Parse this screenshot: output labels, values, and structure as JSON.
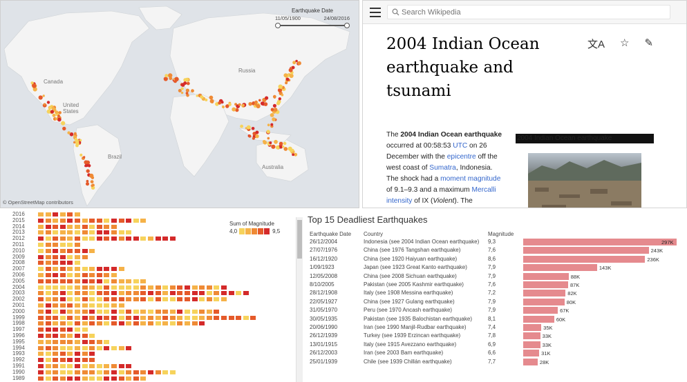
{
  "map": {
    "labels": {
      "canada": "Canada",
      "united_states": "United\nStates",
      "russia": "Russia",
      "brazil": "Brazil",
      "australia": "Australia"
    },
    "copyright": "© OpenStreetMap contributors",
    "slider": {
      "title": "Earthquake Date",
      "start": "11/05/1900",
      "end": "24/08/2016"
    }
  },
  "wiki": {
    "search_placeholder": "Search Wikipedia",
    "title": "2004 Indian Ocean earthquake and tsunami",
    "icons": [
      "translate-icon",
      "star-icon",
      "pencil-icon"
    ],
    "infobox_caption": "2004 Indian Ocean earthquake",
    "body": {
      "t1": "The ",
      "b1": "2004 Indian Ocean earthquake",
      "t2": " occurred at 00:58:53 ",
      "l1": "UTC",
      "t3": " on 26 December with the ",
      "l2": "epicentre",
      "t4": " off the west coast of ",
      "l3": "Sumatra",
      "t5": ", Indonesia. The shock had a ",
      "l4": "moment magnitude",
      "t6": " of 9.1–9.3 and a maximum ",
      "l5": "Mercalli intensity",
      "t7": " of IX (",
      "i1": "Violent",
      "t8": "). The"
    }
  },
  "timeline": {
    "years": [
      "2016",
      "2015",
      "2014",
      "2013",
      "2012",
      "2011",
      "2010",
      "2009",
      "2008",
      "2007",
      "2006",
      "2005",
      "2004",
      "2003",
      "2002",
      "2001",
      "2000",
      "1999",
      "1998",
      "1997",
      "1996",
      "1995",
      "1994",
      "1993",
      "1992",
      "1991",
      "1990",
      "1989"
    ],
    "legend_title": "Sum of Magnitude",
    "legend_min": "4,0",
    "legend_max": "9,5",
    "colors": [
      "#f6d35c",
      "#f5b248",
      "#ef8a35",
      "#e55a2a",
      "#d42a2a"
    ]
  },
  "top15": {
    "title": "Top 15 Deadliest Earthquakes",
    "headers": {
      "date": "Earthquake Date",
      "country": "Country",
      "magnitude": "Magnitude"
    },
    "rows": [
      {
        "date": "26/12/2004",
        "country": "Indonesia (see 2004 Indian Ocean earthquake)",
        "magnitude": "9,3",
        "deaths": 297,
        "label": "297K"
      },
      {
        "date": "27/07/1976",
        "country": "China (see 1976 Tangshan earthquake)",
        "magnitude": "7,6",
        "deaths": 243,
        "label": "243K"
      },
      {
        "date": "16/12/1920",
        "country": "China (see 1920 Haiyuan earthquake)",
        "magnitude": "8,6",
        "deaths": 236,
        "label": "236K"
      },
      {
        "date": "1/09/1923",
        "country": "Japan (see 1923 Great Kanto earthquake)",
        "magnitude": "7,9",
        "deaths": 143,
        "label": "143K"
      },
      {
        "date": "12/05/2008",
        "country": "China (see 2008 Sichuan earthquake)",
        "magnitude": "7,9",
        "deaths": 88,
        "label": "88K"
      },
      {
        "date": "8/10/2005",
        "country": "Pakistan (see 2005 Kashmir earthquake)",
        "magnitude": "7,6",
        "deaths": 87,
        "label": "87K"
      },
      {
        "date": "28/12/1908",
        "country": "Italy (see 1908 Messina earthquake)",
        "magnitude": "7,2",
        "deaths": 82,
        "label": "82K"
      },
      {
        "date": "22/05/1927",
        "country": "China (see 1927 Gulang earthquake)",
        "magnitude": "7,9",
        "deaths": 80,
        "label": "80K"
      },
      {
        "date": "31/05/1970",
        "country": "Peru (see 1970 Ancash earthquake)",
        "magnitude": "7,9",
        "deaths": 67,
        "label": "67K"
      },
      {
        "date": "30/05/1935",
        "country": "Pakistan (see 1935 Balochistan earthquake)",
        "magnitude": "8,1",
        "deaths": 60,
        "label": "60K"
      },
      {
        "date": "20/06/1990",
        "country": "Iran (see 1990 Manjil-Rudbar earthquake)",
        "magnitude": "7,4",
        "deaths": 35,
        "label": "35K"
      },
      {
        "date": "26/12/1939",
        "country": "Turkey (see 1939 Erzincan earthquake)",
        "magnitude": "7,8",
        "deaths": 33,
        "label": "33K"
      },
      {
        "date": "13/01/1915",
        "country": "Italy (see 1915 Avezzano earthquake)",
        "magnitude": "6,9",
        "deaths": 33,
        "label": "33K"
      },
      {
        "date": "26/12/2003",
        "country": "Iran (see 2003 Bam earthquake)",
        "magnitude": "6,6",
        "deaths": 31,
        "label": "31K"
      },
      {
        "date": "25/01/1939",
        "country": "Chile (see 1939 Chillán earthquake)",
        "magnitude": "7,7",
        "deaths": 28,
        "label": "28K"
      }
    ],
    "max_deaths": 297,
    "bar_color": "#e58a8e"
  }
}
